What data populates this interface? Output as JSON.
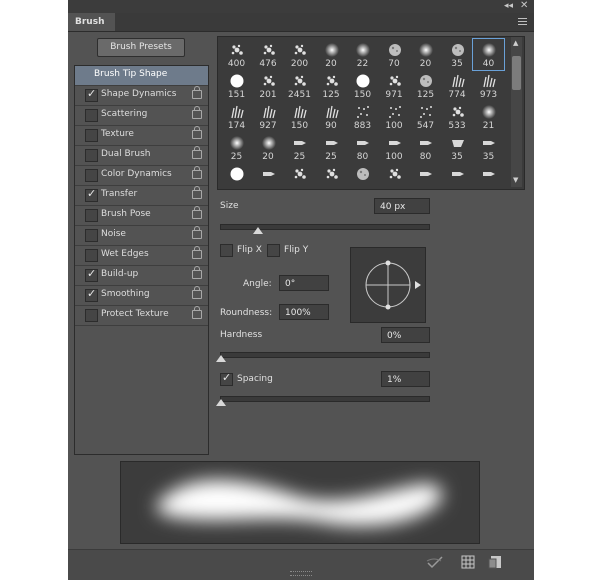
{
  "titlebar": {
    "collapse_glyph": "◂◂",
    "close_glyph": "✕"
  },
  "tab": {
    "label": "Brush"
  },
  "presets_button": "Brush Presets",
  "sections": [
    {
      "label": "Brush Tip Shape",
      "checkable": false,
      "checked": false,
      "selected": true
    },
    {
      "label": "Shape Dynamics",
      "checkable": true,
      "checked": true
    },
    {
      "label": "Scattering",
      "checkable": true,
      "checked": false
    },
    {
      "label": "Texture",
      "checkable": true,
      "checked": false
    },
    {
      "label": "Dual Brush",
      "checkable": true,
      "checked": false
    },
    {
      "label": "Color Dynamics",
      "checkable": true,
      "checked": false
    },
    {
      "label": "Transfer",
      "checkable": true,
      "checked": true
    },
    {
      "label": "Brush Pose",
      "checkable": true,
      "checked": false
    },
    {
      "label": "Noise",
      "checkable": true,
      "checked": false
    },
    {
      "label": "Wet Edges",
      "checkable": true,
      "checked": false
    },
    {
      "label": "Build-up",
      "checkable": true,
      "checked": true
    },
    {
      "label": "Smoothing",
      "checkable": true,
      "checked": true
    },
    {
      "label": "Protect Texture",
      "checkable": true,
      "checked": false
    }
  ],
  "brush_tips": [
    {
      "size": "400",
      "kind": "spatter"
    },
    {
      "size": "476",
      "kind": "spatter"
    },
    {
      "size": "200",
      "kind": "spatter"
    },
    {
      "size": "20",
      "kind": "soft"
    },
    {
      "size": "22",
      "kind": "soft"
    },
    {
      "size": "70",
      "kind": "chalk"
    },
    {
      "size": "20",
      "kind": "soft"
    },
    {
      "size": "35",
      "kind": "chalk"
    },
    {
      "size": "40",
      "kind": "soft",
      "selected": true
    },
    {
      "size": "151",
      "kind": "hard"
    },
    {
      "size": "201",
      "kind": "spatter"
    },
    {
      "size": "2451",
      "kind": "spatter"
    },
    {
      "size": "125",
      "kind": "spatter"
    },
    {
      "size": "150",
      "kind": "hard"
    },
    {
      "size": "971",
      "kind": "spatter"
    },
    {
      "size": "125",
      "kind": "chalk"
    },
    {
      "size": "774",
      "kind": "grass"
    },
    {
      "size": "973",
      "kind": "grass"
    },
    {
      "size": "174",
      "kind": "grass"
    },
    {
      "size": "927",
      "kind": "grass"
    },
    {
      "size": "150",
      "kind": "grass"
    },
    {
      "size": "90",
      "kind": "grass"
    },
    {
      "size": "883",
      "kind": "dots"
    },
    {
      "size": "100",
      "kind": "dots"
    },
    {
      "size": "547",
      "kind": "dots"
    },
    {
      "size": "533",
      "kind": "spatter"
    },
    {
      "size": "21",
      "kind": "soft"
    },
    {
      "size": "25",
      "kind": "soft"
    },
    {
      "size": "20",
      "kind": "soft"
    },
    {
      "size": "25",
      "kind": "pencil"
    },
    {
      "size": "25",
      "kind": "pencil"
    },
    {
      "size": "80",
      "kind": "pencil"
    },
    {
      "size": "100",
      "kind": "pencil"
    },
    {
      "size": "80",
      "kind": "pencil"
    },
    {
      "size": "35",
      "kind": "flat"
    },
    {
      "size": "35",
      "kind": "pencil"
    },
    {
      "size": "",
      "kind": "hard"
    },
    {
      "size": "",
      "kind": "pencil"
    },
    {
      "size": "",
      "kind": "spatter"
    },
    {
      "size": "",
      "kind": "spatter"
    },
    {
      "size": "",
      "kind": "chalk"
    },
    {
      "size": "",
      "kind": "spatter"
    },
    {
      "size": "",
      "kind": "pencil"
    },
    {
      "size": "",
      "kind": "pencil"
    },
    {
      "size": "",
      "kind": "pencil"
    }
  ],
  "size": {
    "label": "Size",
    "value": "40 px",
    "slider_fraction": 0.18
  },
  "flip_x": {
    "label": "Flip X",
    "checked": false
  },
  "flip_y": {
    "label": "Flip Y",
    "checked": false
  },
  "angle": {
    "label": "Angle:",
    "value": "0°"
  },
  "roundness": {
    "label": "Roundness:",
    "value": "100%"
  },
  "hardness": {
    "label": "Hardness",
    "value": "0%",
    "slider_fraction": 0.0
  },
  "spacing": {
    "label": "Spacing",
    "value": "1%",
    "checked": true,
    "slider_fraction": 0.0
  },
  "colors": {
    "panel": "#535353",
    "selection": "#6e7b8b",
    "tip_selected_border": "#6aa1d8"
  },
  "footer_icons": [
    "toggle-hardness-icon",
    "grid-icon",
    "create-preset-icon"
  ]
}
